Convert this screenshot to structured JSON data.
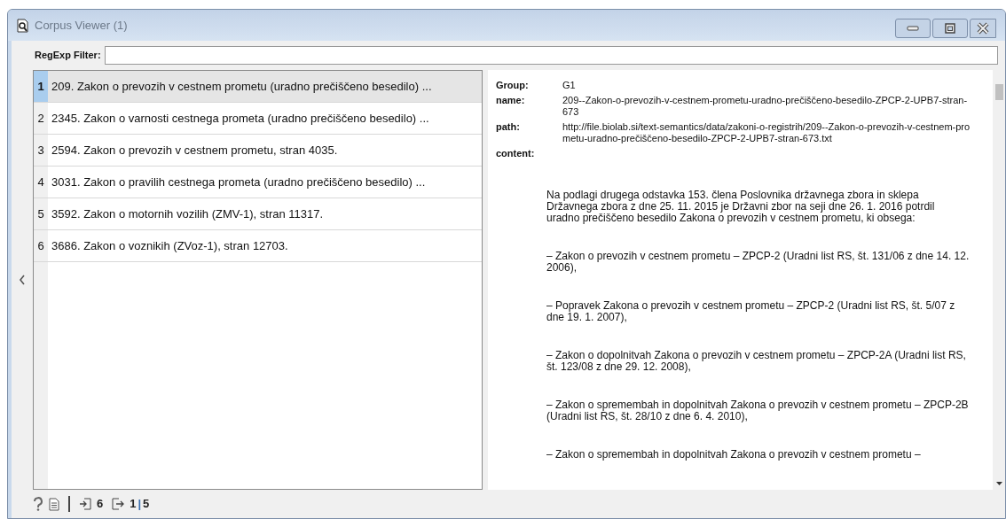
{
  "window": {
    "title": "Corpus Viewer (1)"
  },
  "filter": {
    "label": "RegExp Filter:"
  },
  "documents": [
    {
      "number": "1",
      "title": "209. Zakon o prevozih v cestnem prometu (uradno prečiščeno besedilo) ...",
      "selected": true
    },
    {
      "number": "2",
      "title": "2345. Zakon o varnosti cestnega prometa (uradno prečiščeno besedilo) ...",
      "selected": false
    },
    {
      "number": "3",
      "title": "2594. Zakon o prevozih v cestnem prometu, stran 4035.",
      "selected": false
    },
    {
      "number": "4",
      "title": "3031. Zakon o pravilih cestnega prometa (uradno prečiščeno besedilo) ...",
      "selected": false
    },
    {
      "number": "5",
      "title": "3592. Zakon o motornih vozilih (ZMV-1), stran 11317.",
      "selected": false
    },
    {
      "number": "6",
      "title": "3686. Zakon o voznikih (ZVoz-1), stran 12703.",
      "selected": false
    }
  ],
  "details": {
    "fields": [
      {
        "label": "Group:",
        "value": "G1"
      },
      {
        "label": "name:",
        "value": "209--Zakon-o-prevozih-v-cestnem-prometu-uradno-prečiščeno-besedilo-ZPCP-2-UPB7-stran-673"
      },
      {
        "label": "path:",
        "value": "http://file.biolab.si/text-semantics/data/zakoni-o-registrih/209--Zakon-o-prevozih-v-cestnem-prometu-uradno-prečiščeno-besedilo-ZPCP-2-UPB7-stran-673.txt"
      },
      {
        "label": "content:"
      }
    ],
    "content": [
      "Na podlagi drugega odstavka 153. člena Poslovnika državnega zbora in sklepa Državnega zbora z dne 25. 11. 2015 je Državni zbor na seji dne 26. 1. 2016 potrdil uradno prečiščeno besedilo Zakona o prevozih v cestnem prometu, ki obsega:",
      "– Zakon o prevozih v cestnem prometu – ZPCP-2 (Uradni list RS, št. 131/06 z dne 14. 12. 2006),",
      "– Popravek Zakona o prevozih v cestnem prometu – ZPCP-2 (Uradni list RS, št. 5/07 z dne 19. 1. 2007),",
      "– Zakon o dopolnitvah Zakona o prevozih v cestnem prometu – ZPCP-2A (Uradni list RS, št. 123/08 z dne 29. 12. 2008),",
      "– Zakon o spremembah in dopolnitvah Zakona o prevozih v cestnem prometu – ZPCP-2B (Uradni list RS, št. 28/10 z dne 6. 4. 2010),",
      "– Zakon o spremembah in dopolnitvah Zakona o prevozih v cestnem prometu –"
    ]
  },
  "status_bar": {
    "input_count": "6",
    "output_count": "1",
    "output_separator": "|",
    "output_total": "5"
  }
}
